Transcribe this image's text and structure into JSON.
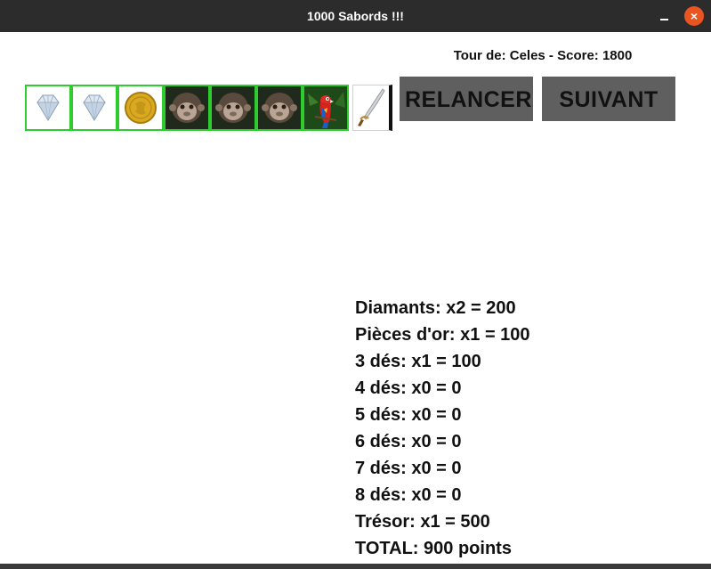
{
  "window": {
    "title": "1000 Sabords !!!",
    "close_symbol": "×"
  },
  "status": {
    "text": "Tour de: Celes - Score: 1800"
  },
  "dice": [
    {
      "face": "diamond",
      "icon": "diamond-icon"
    },
    {
      "face": "diamond",
      "icon": "diamond-icon"
    },
    {
      "face": "gold coin",
      "icon": "gold-coin-icon"
    },
    {
      "face": "monkey",
      "icon": "monkey-icon"
    },
    {
      "face": "monkey",
      "icon": "monkey-icon"
    },
    {
      "face": "monkey",
      "icon": "monkey-icon"
    },
    {
      "face": "parrot",
      "icon": "parrot-icon"
    },
    {
      "face": "sabre",
      "icon": "sabre-icon"
    }
  ],
  "buttons": {
    "relancer": "RELANCER",
    "suivant": "SUIVANT"
  },
  "scores": [
    "Diamants: x2 = 200",
    "Pièces d'or: x1 = 100",
    "3 dés: x1 = 100",
    "4 dés: x0 = 0",
    "5 dés: x0 = 0",
    "6 dés: x0 = 0",
    "7 dés: x0 = 0",
    "8 dés: x0 = 0",
    "Trésor: x1 = 500",
    "TOTAL: 900 points"
  ],
  "colors": {
    "titlebar": "#2c2c2c",
    "close_button": "#e95420",
    "selected_border": "#2ecc2e",
    "button_bg": "#5f5f5f"
  }
}
